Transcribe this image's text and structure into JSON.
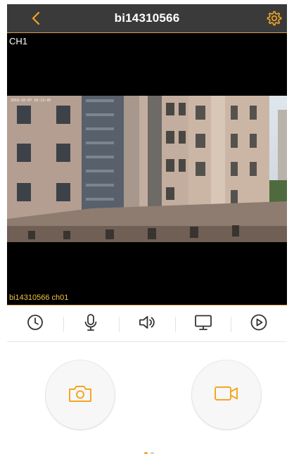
{
  "header": {
    "title": "bi14310566",
    "back_icon": "chevron-left-icon",
    "settings_icon": "gear-icon"
  },
  "video": {
    "channel_label": "CH1",
    "osd_timestamp": "2019-10-07 10:13:45",
    "camera_name": "bi14310566 ch01"
  },
  "toolbar": {
    "items": [
      {
        "icon": "clock-icon"
      },
      {
        "icon": "microphone-icon"
      },
      {
        "icon": "speaker-icon"
      },
      {
        "icon": "monitor-icon"
      },
      {
        "icon": "play-icon"
      }
    ]
  },
  "actions": {
    "snapshot_icon": "camera-icon",
    "record_icon": "video-camera-icon"
  },
  "pager": {
    "count": 2,
    "active_index": 0
  },
  "colors": {
    "accent": "#f5a623",
    "topbar": "#3a3a3a",
    "camera_name": "#f3c43b",
    "video_border": "#d9a050"
  }
}
